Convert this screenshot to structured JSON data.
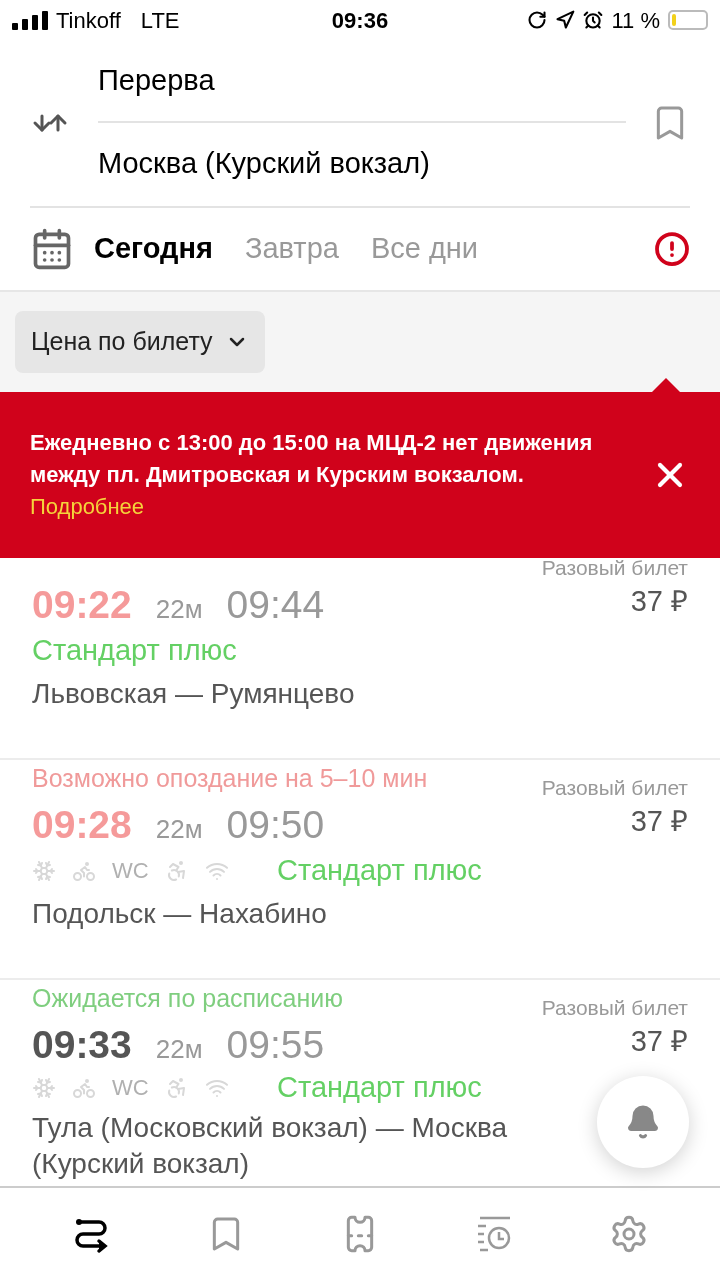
{
  "status_bar": {
    "carrier": "Tinkoff",
    "network": "LTE",
    "time": "09:36",
    "battery": "11 %"
  },
  "route": {
    "from": "Перерва",
    "to": "Москва (Курский вокзал)"
  },
  "day_tabs": [
    {
      "label": "Сегодня",
      "selected": true
    },
    {
      "label": "Завтра",
      "selected": false
    },
    {
      "label": "Все дни",
      "selected": false
    }
  ],
  "filter": {
    "label": "Цена по билету"
  },
  "banner": {
    "text": "Ежедневно с 13:00 до 15:00 на МЦД-2 нет движения между пл. Дмитровская и Курским вокзалом.",
    "link": "Подробнее"
  },
  "trains": [
    {
      "kind": "delay",
      "departure": "09:22",
      "duration": "22м",
      "arrival": "09:44",
      "train_class": "Стандарт плюс",
      "route": "Львовская — Румянцево",
      "ticket_type": "Разовый билет",
      "price": "37 ₽"
    },
    {
      "status": "Возможно опоздание на 5–10 мин",
      "kind": "delay",
      "departure": "09:28",
      "duration": "22м",
      "arrival": "09:50",
      "amenities": [
        {
          "kind": "snowflake"
        },
        {
          "kind": "bike"
        },
        {
          "kind": "wc",
          "label": "WC"
        },
        {
          "kind": "accessible"
        },
        {
          "kind": "wifi"
        }
      ],
      "train_class": "Стандарт плюс",
      "route": "Подольск — Нахабино",
      "ticket_type": "Разовый билет",
      "price": "37 ₽"
    },
    {
      "status": "Ожидается по расписанию",
      "kind": "ontime",
      "departure": "09:33",
      "duration": "22м",
      "arrival": "09:55",
      "amenities": [
        {
          "kind": "snowflake"
        },
        {
          "kind": "bike"
        },
        {
          "kind": "wc",
          "label": "WC"
        },
        {
          "kind": "accessible"
        },
        {
          "kind": "wifi"
        }
      ],
      "train_class": "Стандарт плюс",
      "route": "Тула (Московский вокзал) — Москва (Курский вокзал)",
      "ticket_type": "Разовый билет",
      "price": "37 ₽"
    }
  ],
  "tab_bar": [
    {
      "kind": "route",
      "selected": true
    },
    {
      "kind": "bookmark",
      "selected": false
    },
    {
      "kind": "ticket",
      "selected": false
    },
    {
      "kind": "history",
      "selected": false
    },
    {
      "kind": "settings",
      "selected": false
    }
  ]
}
